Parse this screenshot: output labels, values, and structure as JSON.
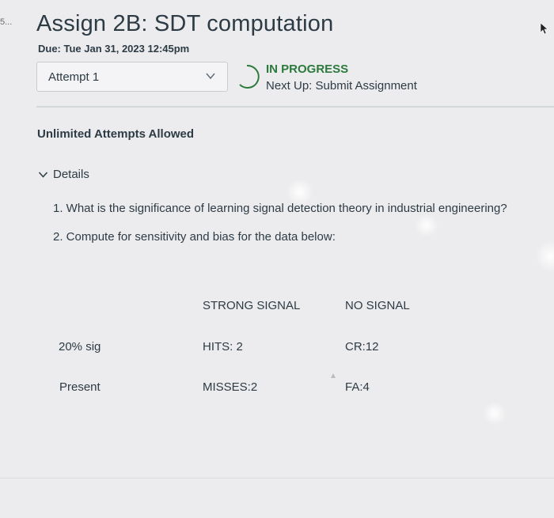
{
  "corner_text": "5...",
  "header": {
    "title": "Assign 2B: SDT computation",
    "due": "Due: Tue Jan 31, 2023 12:45pm"
  },
  "attempt": {
    "selected": "Attempt 1",
    "status": "IN PROGRESS",
    "next_up": "Next Up: Submit Assignment"
  },
  "attempts_note": "Unlimited Attempts Allowed",
  "details": {
    "toggle_label": "Details",
    "questions": [
      "1. What is the significance of learning signal detection theory in industrial engineering?",
      "2. Compute for sensitivity and bias for the data below:"
    ],
    "table": {
      "headers": [
        "",
        "STRONG SIGNAL",
        "NO SIGNAL"
      ],
      "rows": [
        [
          "20% sig",
          "HITS: 2",
          "CR:12"
        ],
        [
          "Present",
          "MISSES:2",
          "FA:4"
        ]
      ]
    }
  },
  "icons": {
    "select_chevron": "chevron-down-icon",
    "status": "progress-ring-icon",
    "details": "chevron-down-icon",
    "cursor": "mouse-pointer-icon"
  },
  "colors": {
    "background": "#ececee",
    "text": "#2d3b45",
    "status_green": "#2b7a3c",
    "border": "#c7cdd1"
  }
}
